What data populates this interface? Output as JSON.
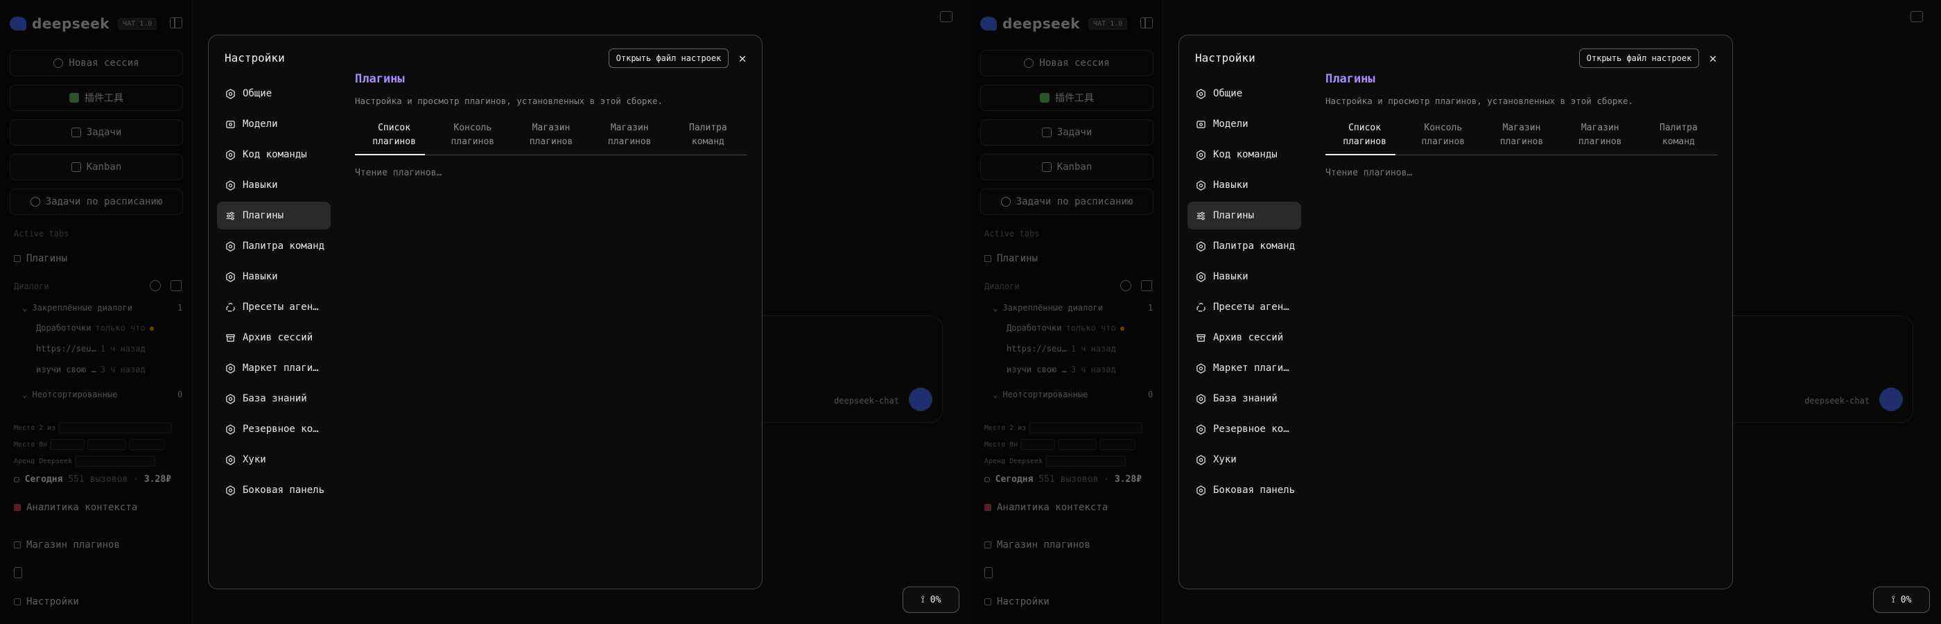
{
  "app": {
    "brand": "deepseek",
    "brand_badge": "ЧАТ 1.0",
    "new_session": "Новая сессия",
    "plugin_tool": "插件工具",
    "tasks": "Задачи",
    "kanban": "Kanban",
    "scheduled": "Задачи по расписанию",
    "active_tabs_label": "Active tabs",
    "active_tab_item": "Плагины",
    "dialogs_label": "Диалоги",
    "pinned_label": "Закреплённые диалоги",
    "pinned_count": "1",
    "dialog_1": "Доработочки",
    "dialog_1_meta": "только что",
    "dialog_2": "https://seu…",
    "dialog_2_meta": "1 ч назад",
    "dialog_3": "изучи свою …",
    "dialog_3_meta": "3 ч назад",
    "unsorted_label": "Неотсортированные",
    "unsorted_count": "0",
    "stats_1": "Место 2 из",
    "stats_2": "Место 8н",
    "stats_3": "Аренд Deepseek",
    "today_label": "Сегодня",
    "today_calls": "551 вызовов",
    "today_cost": "3.28₽",
    "context_analytics": "Аналитика контекста",
    "plugin_store": "Магазин плагинов",
    "settings": "Настройки",
    "composer_model": "deepseek-chat",
    "progress": "0%"
  },
  "modal": {
    "title": "Настройки",
    "open_file": "Открыть файл настроек",
    "nav": [
      {
        "label": "Общие",
        "icon": "gear-icon"
      },
      {
        "label": "Модели",
        "icon": "models-icon"
      },
      {
        "label": "Код команды",
        "icon": "gear-icon"
      },
      {
        "label": "Навыки",
        "icon": "gear-icon"
      },
      {
        "label": "Плагины",
        "icon": "sliders-icon"
      },
      {
        "label": "Палитра команд",
        "icon": "gear-icon"
      },
      {
        "label": "Навыки",
        "icon": "gear-icon"
      },
      {
        "label": "Пресеты агентов",
        "icon": "recycle-icon"
      },
      {
        "label": "Архив сессий",
        "icon": "archive-icon"
      },
      {
        "label": "Маркет плагинов",
        "icon": "gear-icon"
      },
      {
        "label": "База знаний",
        "icon": "gear-icon"
      },
      {
        "label": "Резервное копирование",
        "icon": "gear-icon"
      },
      {
        "label": "Хуки",
        "icon": "gear-icon"
      },
      {
        "label": "Боковая панель",
        "icon": "gear-icon"
      }
    ],
    "content": {
      "title": "Плагины",
      "subtitle": "Настройка и просмотр плагинов, установленных в этой сборке.",
      "tabs": [
        {
          "l1": "Список",
          "l2": "плагинов"
        },
        {
          "l1": "Консоль",
          "l2": "плагинов"
        },
        {
          "l1": "Магазин",
          "l2": "плагинов"
        },
        {
          "l1": "Магазин",
          "l2": "плагинов"
        },
        {
          "l1": "Палитра",
          "l2": "команд"
        }
      ],
      "loading": "Чтение плагинов…"
    }
  },
  "colors": {
    "accent_purple": "#a78bfa",
    "brand_blue": "#4d6bfe"
  }
}
